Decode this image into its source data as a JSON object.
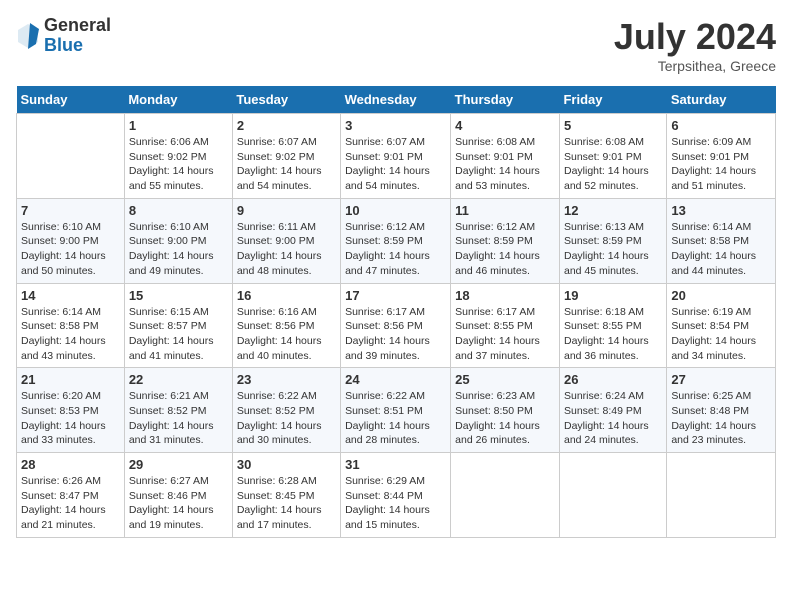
{
  "logo": {
    "general": "General",
    "blue": "Blue"
  },
  "title": "July 2024",
  "subtitle": "Terpsithea, Greece",
  "days_header": [
    "Sunday",
    "Monday",
    "Tuesday",
    "Wednesday",
    "Thursday",
    "Friday",
    "Saturday"
  ],
  "weeks": [
    [
      {
        "day": "",
        "info": ""
      },
      {
        "day": "1",
        "info": "Sunrise: 6:06 AM\nSunset: 9:02 PM\nDaylight: 14 hours\nand 55 minutes."
      },
      {
        "day": "2",
        "info": "Sunrise: 6:07 AM\nSunset: 9:02 PM\nDaylight: 14 hours\nand 54 minutes."
      },
      {
        "day": "3",
        "info": "Sunrise: 6:07 AM\nSunset: 9:01 PM\nDaylight: 14 hours\nand 54 minutes."
      },
      {
        "day": "4",
        "info": "Sunrise: 6:08 AM\nSunset: 9:01 PM\nDaylight: 14 hours\nand 53 minutes."
      },
      {
        "day": "5",
        "info": "Sunrise: 6:08 AM\nSunset: 9:01 PM\nDaylight: 14 hours\nand 52 minutes."
      },
      {
        "day": "6",
        "info": "Sunrise: 6:09 AM\nSunset: 9:01 PM\nDaylight: 14 hours\nand 51 minutes."
      }
    ],
    [
      {
        "day": "7",
        "info": "Sunrise: 6:10 AM\nSunset: 9:00 PM\nDaylight: 14 hours\nand 50 minutes."
      },
      {
        "day": "8",
        "info": "Sunrise: 6:10 AM\nSunset: 9:00 PM\nDaylight: 14 hours\nand 49 minutes."
      },
      {
        "day": "9",
        "info": "Sunrise: 6:11 AM\nSunset: 9:00 PM\nDaylight: 14 hours\nand 48 minutes."
      },
      {
        "day": "10",
        "info": "Sunrise: 6:12 AM\nSunset: 8:59 PM\nDaylight: 14 hours\nand 47 minutes."
      },
      {
        "day": "11",
        "info": "Sunrise: 6:12 AM\nSunset: 8:59 PM\nDaylight: 14 hours\nand 46 minutes."
      },
      {
        "day": "12",
        "info": "Sunrise: 6:13 AM\nSunset: 8:59 PM\nDaylight: 14 hours\nand 45 minutes."
      },
      {
        "day": "13",
        "info": "Sunrise: 6:14 AM\nSunset: 8:58 PM\nDaylight: 14 hours\nand 44 minutes."
      }
    ],
    [
      {
        "day": "14",
        "info": "Sunrise: 6:14 AM\nSunset: 8:58 PM\nDaylight: 14 hours\nand 43 minutes."
      },
      {
        "day": "15",
        "info": "Sunrise: 6:15 AM\nSunset: 8:57 PM\nDaylight: 14 hours\nand 41 minutes."
      },
      {
        "day": "16",
        "info": "Sunrise: 6:16 AM\nSunset: 8:56 PM\nDaylight: 14 hours\nand 40 minutes."
      },
      {
        "day": "17",
        "info": "Sunrise: 6:17 AM\nSunset: 8:56 PM\nDaylight: 14 hours\nand 39 minutes."
      },
      {
        "day": "18",
        "info": "Sunrise: 6:17 AM\nSunset: 8:55 PM\nDaylight: 14 hours\nand 37 minutes."
      },
      {
        "day": "19",
        "info": "Sunrise: 6:18 AM\nSunset: 8:55 PM\nDaylight: 14 hours\nand 36 minutes."
      },
      {
        "day": "20",
        "info": "Sunrise: 6:19 AM\nSunset: 8:54 PM\nDaylight: 14 hours\nand 34 minutes."
      }
    ],
    [
      {
        "day": "21",
        "info": "Sunrise: 6:20 AM\nSunset: 8:53 PM\nDaylight: 14 hours\nand 33 minutes."
      },
      {
        "day": "22",
        "info": "Sunrise: 6:21 AM\nSunset: 8:52 PM\nDaylight: 14 hours\nand 31 minutes."
      },
      {
        "day": "23",
        "info": "Sunrise: 6:22 AM\nSunset: 8:52 PM\nDaylight: 14 hours\nand 30 minutes."
      },
      {
        "day": "24",
        "info": "Sunrise: 6:22 AM\nSunset: 8:51 PM\nDaylight: 14 hours\nand 28 minutes."
      },
      {
        "day": "25",
        "info": "Sunrise: 6:23 AM\nSunset: 8:50 PM\nDaylight: 14 hours\nand 26 minutes."
      },
      {
        "day": "26",
        "info": "Sunrise: 6:24 AM\nSunset: 8:49 PM\nDaylight: 14 hours\nand 24 minutes."
      },
      {
        "day": "27",
        "info": "Sunrise: 6:25 AM\nSunset: 8:48 PM\nDaylight: 14 hours\nand 23 minutes."
      }
    ],
    [
      {
        "day": "28",
        "info": "Sunrise: 6:26 AM\nSunset: 8:47 PM\nDaylight: 14 hours\nand 21 minutes."
      },
      {
        "day": "29",
        "info": "Sunrise: 6:27 AM\nSunset: 8:46 PM\nDaylight: 14 hours\nand 19 minutes."
      },
      {
        "day": "30",
        "info": "Sunrise: 6:28 AM\nSunset: 8:45 PM\nDaylight: 14 hours\nand 17 minutes."
      },
      {
        "day": "31",
        "info": "Sunrise: 6:29 AM\nSunset: 8:44 PM\nDaylight: 14 hours\nand 15 minutes."
      },
      {
        "day": "",
        "info": ""
      },
      {
        "day": "",
        "info": ""
      },
      {
        "day": "",
        "info": ""
      }
    ]
  ]
}
